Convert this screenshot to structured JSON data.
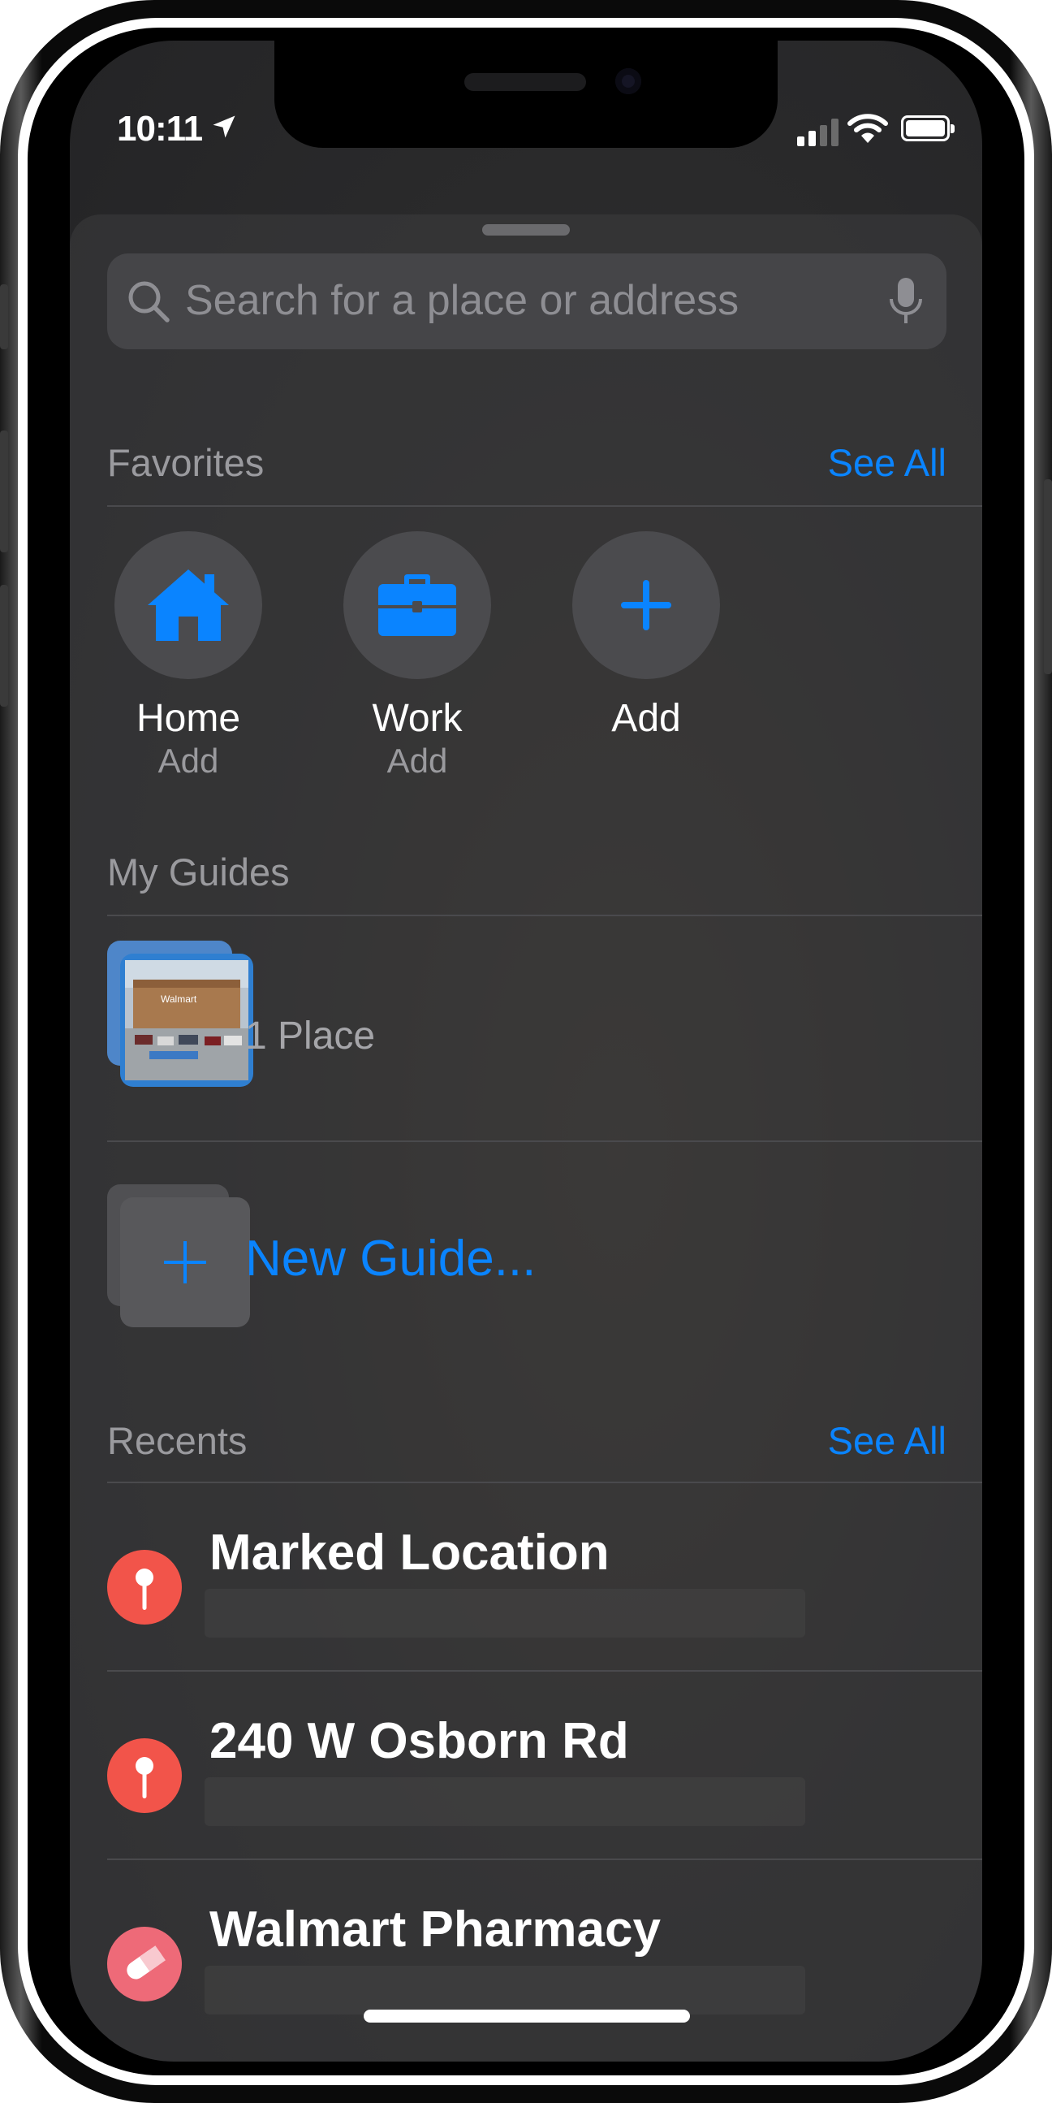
{
  "status_bar": {
    "time": "10:11"
  },
  "search": {
    "placeholder": "Search for a place or address"
  },
  "favorites": {
    "title": "Favorites",
    "see_all": "See All",
    "items": [
      {
        "label": "Home",
        "sublabel": "Add",
        "icon": "house-icon"
      },
      {
        "label": "Work",
        "sublabel": "Add",
        "icon": "briefcase-icon"
      },
      {
        "label": "Add",
        "sublabel": "",
        "icon": "plus-icon"
      }
    ]
  },
  "guides": {
    "title": "My Guides",
    "items": [
      {
        "count": "1 Place",
        "thumbnail": "walmart-storefront-photo"
      }
    ],
    "new_guide": "New Guide..."
  },
  "recents": {
    "title": "Recents",
    "see_all": "See All",
    "items": [
      {
        "title": "Marked Location",
        "icon": "pin-icon",
        "color": "#f2544a"
      },
      {
        "title": "240 W Osborn Rd",
        "icon": "pin-icon",
        "color": "#f2544a"
      },
      {
        "title": "Walmart Pharmacy",
        "icon": "pill-icon",
        "color": "#ee6a78"
      }
    ]
  },
  "colors": {
    "accent": "#0a84ff",
    "sheet": "#3a3a3c"
  }
}
